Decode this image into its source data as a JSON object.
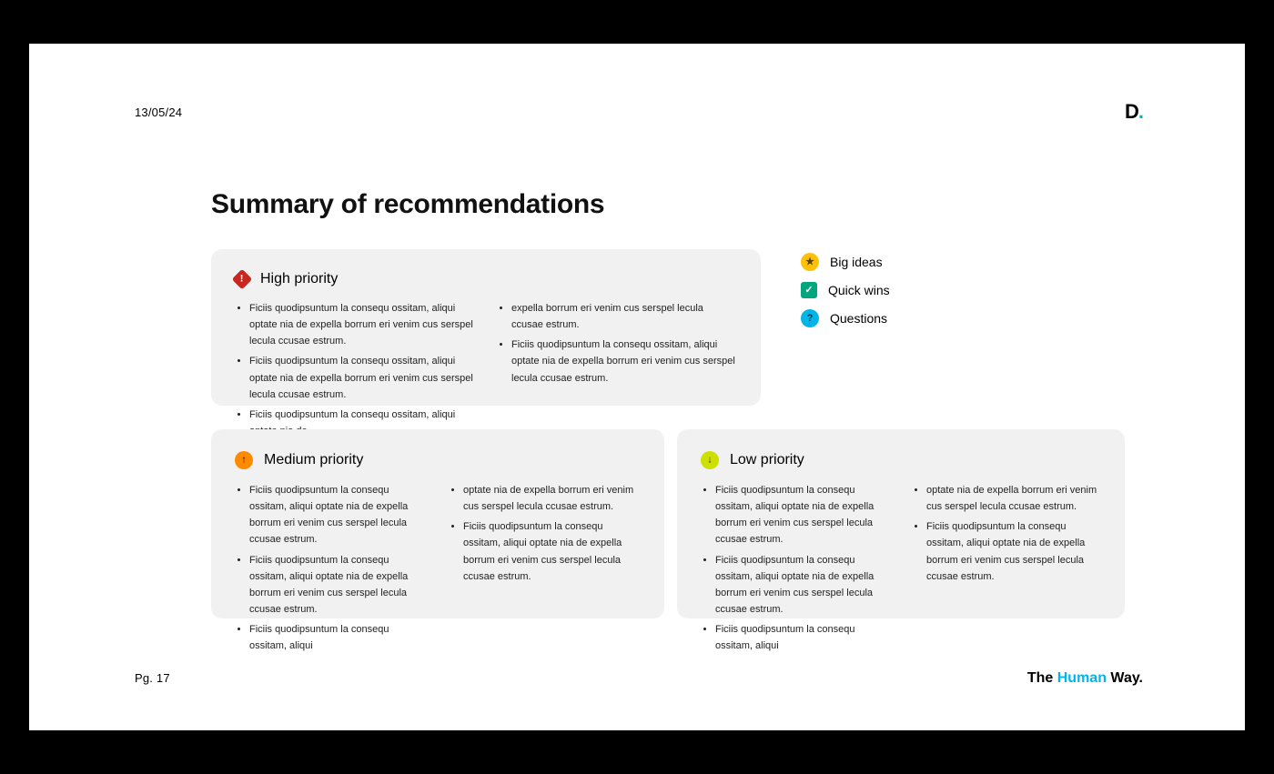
{
  "header": {
    "date": "13/05/24",
    "logo_text": "D",
    "logo_dot": "."
  },
  "title": "Summary of recommendations",
  "cards": {
    "high": {
      "label": "High priority",
      "col1": [
        "Ficiis quodipsuntum la consequ ossitam, aliqui optate nia de expella borrum eri venim cus serspel lecula ccusae estrum.",
        "Ficiis quodipsuntum la consequ ossitam, aliqui optate nia de expella borrum eri venim cus serspel lecula ccusae estrum.",
        "Ficiis quodipsuntum la consequ ossitam, aliqui optate nia de"
      ],
      "col2": [
        "expella borrum eri venim cus serspel lecula ccusae estrum.",
        "Ficiis quodipsuntum la consequ ossitam, aliqui optate nia de expella borrum eri venim cus serspel lecula ccusae estrum."
      ]
    },
    "medium": {
      "label": "Medium priority",
      "col1": [
        "Ficiis quodipsuntum la consequ ossitam, aliqui optate nia de expella borrum eri venim cus serspel lecula ccusae estrum.",
        "Ficiis quodipsuntum la consequ ossitam, aliqui optate nia de expella borrum eri venim cus serspel lecula ccusae estrum.",
        "Ficiis quodipsuntum la consequ ossitam, aliqui"
      ],
      "col2": [
        "optate nia de expella borrum eri venim cus serspel lecula ccusae estrum.",
        "Ficiis quodipsuntum la consequ ossitam, aliqui optate nia de expella borrum eri venim cus serspel lecula ccusae estrum."
      ]
    },
    "low": {
      "label": "Low priority",
      "col1": [
        "Ficiis quodipsuntum la consequ ossitam, aliqui optate nia de expella borrum eri venim cus serspel lecula ccusae estrum.",
        "Ficiis quodipsuntum la consequ ossitam, aliqui optate nia de expella borrum eri venim cus serspel lecula ccusae estrum.",
        "Ficiis quodipsuntum la consequ ossitam, aliqui"
      ],
      "col2": [
        "optate nia de expella borrum eri venim cus serspel lecula ccusae estrum.",
        "Ficiis quodipsuntum la consequ ossitam, aliqui optate nia de expella borrum eri venim cus serspel lecula ccusae estrum."
      ]
    }
  },
  "legend": {
    "big_ideas": "Big ideas",
    "quick_wins": "Quick wins",
    "questions": "Questions"
  },
  "footer": {
    "page": "Pg. 17",
    "tag_pre": "The ",
    "tag_accent": "Human",
    "tag_post": " Way."
  }
}
